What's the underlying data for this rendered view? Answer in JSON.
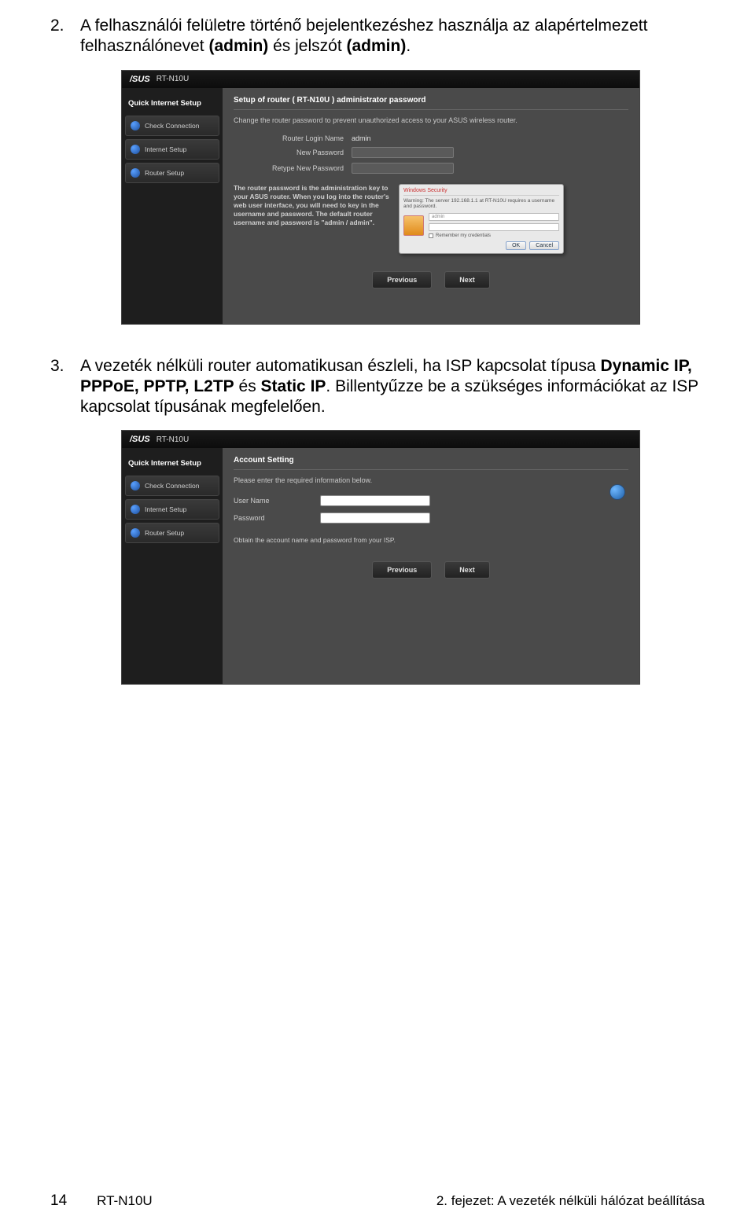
{
  "instructions": {
    "step2": {
      "num": "2.",
      "text_pre": "A felhasználói felületre történő bejelentkezéshez használja az alapértelmezett felhasználónevet ",
      "bold1": "(admin)",
      "text_mid": " és jelszót ",
      "bold2": "(admin)",
      "text_post": "."
    },
    "step3": {
      "num": "3.",
      "text_pre": "A vezeték nélküli router automatikusan észleli, ha ISP kapcsolat típusa ",
      "bold": "Dynamic IP, PPPoE, PPTP, L2TP",
      "text_mid": " és ",
      "bold2": "Static IP",
      "text_post": ". Billentyűzze be a szükséges információkat az ISP kapcsolat típusának megfelelően."
    }
  },
  "shot1": {
    "brand": "/SUS",
    "model": "RT-N10U",
    "sidebar_head": "Quick Internet Setup",
    "sidebar_items": [
      "Check Connection",
      "Internet Setup",
      "Router Setup"
    ],
    "panel_title": "Setup of router ( RT-N10U ) administrator password",
    "panel_desc": "Change the router password to prevent unauthorized access to your ASUS wireless router.",
    "rows": {
      "login_name_label": "Router Login Name",
      "login_name_value": "admin",
      "newpw_label": "New Password",
      "retypepw_label": "Retype New Password"
    },
    "info_text": "The router password is the administration key to your ASUS router. When you log into the router's web user interface, you will need to key in the username and password. The default router username and password is \"admin / admin\".",
    "popup": {
      "title": "Windows Security",
      "warn": "Warning: The server 192.168.1.1 at RT-N10U requires a username and password.",
      "field_user": "admin",
      "field_pass": "",
      "remember": "Remember my credentials",
      "ok": "OK",
      "cancel": "Cancel"
    },
    "nav_prev": "Previous",
    "nav_next": "Next"
  },
  "shot2": {
    "brand": "/SUS",
    "model": "RT-N10U",
    "sidebar_head": "Quick Internet Setup",
    "sidebar_items": [
      "Check Connection",
      "Internet Setup",
      "Router Setup"
    ],
    "panel_title": "Account Setting",
    "panel_desc": "Please enter the required information below.",
    "rows": {
      "user_label": "User Name",
      "pw_label": "Password"
    },
    "hint": "Obtain the account name and password from your ISP.",
    "nav_prev": "Previous",
    "nav_next": "Next"
  },
  "footer": {
    "page": "14",
    "model": "RT-N10U",
    "chapter": "2. fejezet: A vezeték nélküli hálózat beállítása"
  }
}
